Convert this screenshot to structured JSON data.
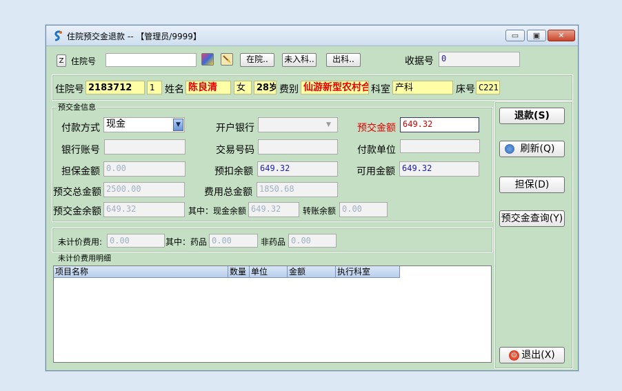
{
  "window": {
    "title": "住院预交金退款 -- 【管理员/9999】",
    "minimize": "▭",
    "restore": "▣",
    "close": "✕"
  },
  "search": {
    "z_button": "Z",
    "inpatient_no_label": "住院号",
    "inpatient_no_value": "",
    "btn_in_hospital": "在院..",
    "btn_not_admitted": "未入科..",
    "btn_discharged": "出科..",
    "receipt_no_label": "收据号",
    "receipt_no_value": "0"
  },
  "patient": {
    "inpatient_no_label": "住院号",
    "inpatient_no_value": "2183712",
    "times_value": "1",
    "name_label": "姓名",
    "name_value": "陈良清",
    "gender_value": "女",
    "age_value": "28岁",
    "fee_type_label": "费别",
    "fee_type_value": "仙游新型农村合作",
    "dept_label": "科室",
    "dept_value": "产科",
    "bed_label": "床号",
    "bed_value": "C221"
  },
  "deposit": {
    "group_title": "预交金信息",
    "payment_method_label": "付款方式",
    "payment_method_value": "现金",
    "bank_label": "开户银行",
    "bank_value": "",
    "deposit_amount_label": "预交金额",
    "deposit_amount_value": "649.32",
    "bank_account_label": "银行账号",
    "bank_account_value": "",
    "transaction_no_label": "交易号码",
    "transaction_no_value": "",
    "payer_label": "付款单位",
    "payer_value": "",
    "guarantee_label": "担保金额",
    "guarantee_value": "0.00",
    "prededuct_label": "预扣余额",
    "prededuct_value": "649.32",
    "available_label": "可用金额",
    "available_value": "649.32",
    "total_deposit_label": "预交总金额",
    "total_deposit_value": "2500.00",
    "total_fee_label": "费用总金额",
    "total_fee_value": "1850.68",
    "deposit_balance_label": "预交金余额",
    "deposit_balance_value": "649.32",
    "cash_balance_label": "其中：现金余额",
    "cash_balance_value": "649.32",
    "transfer_balance_label": "转账余额",
    "transfer_balance_value": "0.00"
  },
  "unpriced": {
    "label": "未计价费用:",
    "value": "0.00",
    "drug_label": "其中：药品",
    "drug_value": "0.00",
    "nondrug_label": "非药品",
    "nondrug_value": "0.00"
  },
  "detail": {
    "group_title": "未计价费用明细",
    "columns": [
      "项目名称",
      "数量",
      "单位",
      "金额",
      "执行科室"
    ]
  },
  "actions": {
    "refund": "退款(S)",
    "refresh": "刷新(Q)",
    "guarantee": "担保(D)",
    "deposit_query": "预交金查询(Y)",
    "exit": "退出(X)"
  },
  "colors": {
    "window_bg": "#c4dfc4",
    "highlight_field": "#ffffa8",
    "alert_text": "#e60000",
    "value_blue": "#1c1ca8"
  }
}
